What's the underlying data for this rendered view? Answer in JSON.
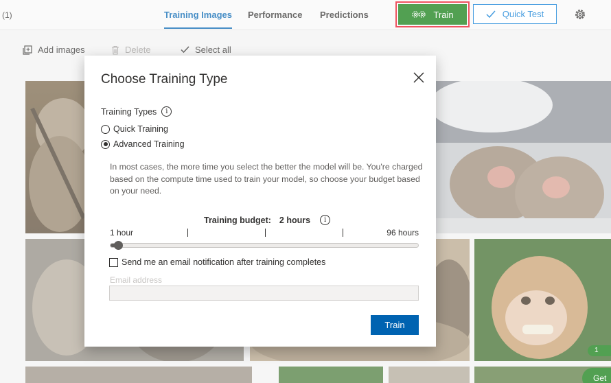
{
  "header": {
    "crumb": "(1)",
    "tabs": [
      "Training Images",
      "Performance",
      "Predictions"
    ],
    "active_tab": "Training Images",
    "train_label": "Train",
    "quick_test_label": "Quick Test"
  },
  "toolbar": {
    "add_images": "Add images",
    "delete": "Delete",
    "select_all": "Select all"
  },
  "gallery": {
    "tile_tag": "1",
    "get_button": "Get"
  },
  "dialog": {
    "title": "Choose Training Type",
    "training_types_label": "Training Types",
    "options": [
      "Quick Training",
      "Advanced Training"
    ],
    "selected_option": "Advanced Training",
    "description": "In most cases, the more time you select the better the model will be. You're charged based on the compute time used to train your model, so choose your budget based on your need.",
    "budget_label": "Training budget:",
    "budget_value": "2 hours",
    "budget_min": "1 hour",
    "budget_max": "96 hours",
    "budget_hours": 2,
    "budget_range": [
      1,
      96
    ],
    "email_checkbox_label": "Send me an email notification after training completes",
    "email_checked": false,
    "email_label": "Email address",
    "email_value": "",
    "train_button": "Train"
  },
  "colors": {
    "primary_blue": "#0063b1",
    "train_green": "#107c10",
    "highlight_red": "#e81123"
  },
  "icons": {
    "train": "gears-icon",
    "quick_test": "checkmark-icon",
    "settings": "gear-icon",
    "add_images": "add-images-icon",
    "delete": "trash-icon",
    "select_all": "checkmark-icon",
    "close": "close-icon",
    "info": "info-icon"
  }
}
